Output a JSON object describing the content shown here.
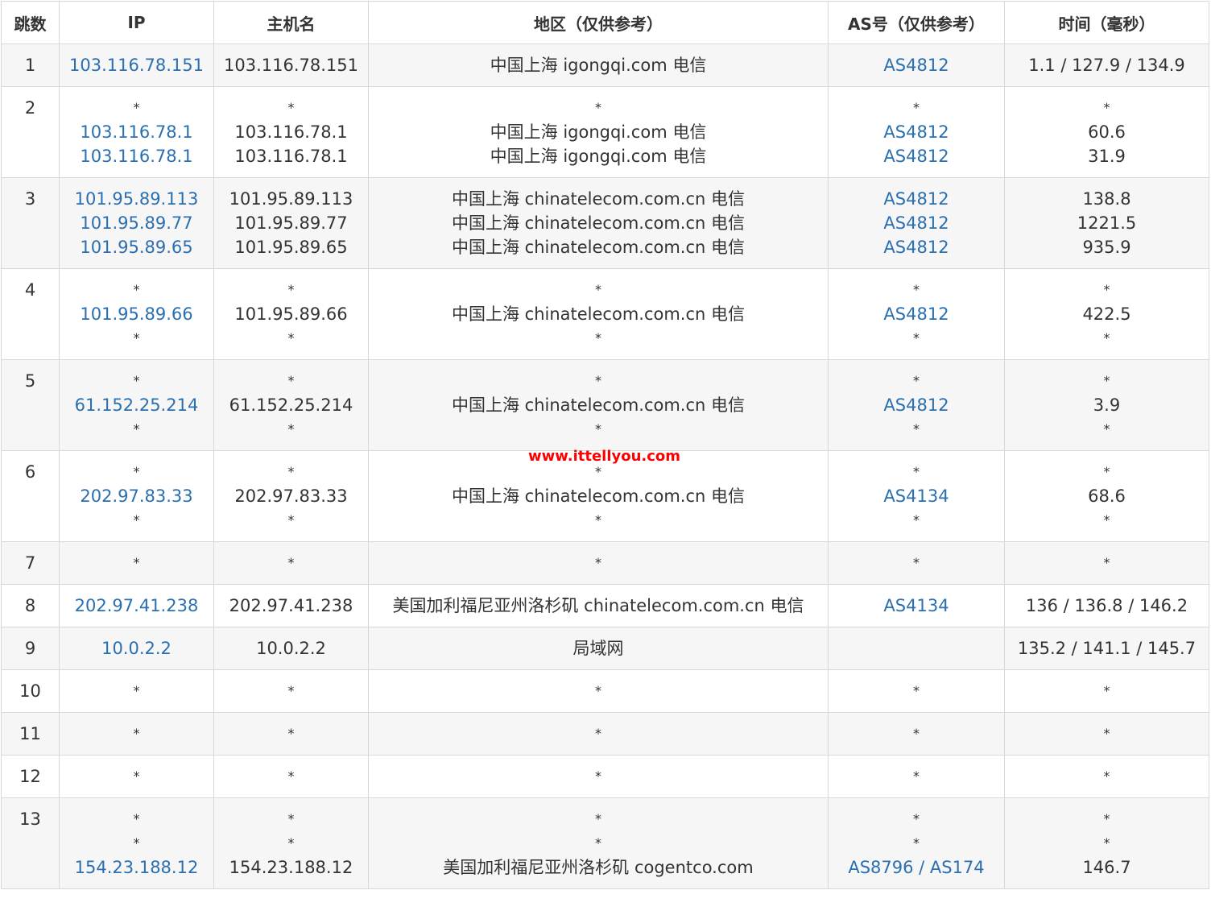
{
  "colors": {
    "link": "#2a6fb0",
    "text": "#333333",
    "stripe": "#f6f6f6",
    "border": "#d8d8d8",
    "watermark": "#ff0000"
  },
  "headers": [
    "跳数",
    "IP",
    "主机名",
    "地区（仅供参考）",
    "AS号（仅供参考）",
    "时间（毫秒）"
  ],
  "watermark": "www.ittellyou.com",
  "rows": [
    {
      "hop": "1",
      "ip": [
        "103.116.78.151"
      ],
      "host": [
        "103.116.78.151"
      ],
      "region": [
        "中国上海 igongqi.com 电信"
      ],
      "as": [
        "AS4812"
      ],
      "time": [
        "1.1 / 127.9 / 134.9"
      ]
    },
    {
      "hop": "2",
      "ip": [
        "*",
        "103.116.78.1",
        "103.116.78.1"
      ],
      "host": [
        "*",
        "103.116.78.1",
        "103.116.78.1"
      ],
      "region": [
        "*",
        "中国上海 igongqi.com 电信",
        "中国上海 igongqi.com 电信"
      ],
      "as": [
        "*",
        "AS4812",
        "AS4812"
      ],
      "time": [
        "*",
        "60.6",
        "31.9"
      ]
    },
    {
      "hop": "3",
      "ip": [
        "101.95.89.113",
        "101.95.89.77",
        "101.95.89.65"
      ],
      "host": [
        "101.95.89.113",
        "101.95.89.77",
        "101.95.89.65"
      ],
      "region": [
        "中国上海 chinatelecom.com.cn 电信",
        "中国上海 chinatelecom.com.cn 电信",
        "中国上海 chinatelecom.com.cn 电信"
      ],
      "as": [
        "AS4812",
        "AS4812",
        "AS4812"
      ],
      "time": [
        "138.8",
        "1221.5",
        "935.9"
      ]
    },
    {
      "hop": "4",
      "ip": [
        "*",
        "101.95.89.66",
        "*"
      ],
      "host": [
        "*",
        "101.95.89.66",
        "*"
      ],
      "region": [
        "*",
        "中国上海 chinatelecom.com.cn 电信",
        "*"
      ],
      "as": [
        "*",
        "AS4812",
        "*"
      ],
      "time": [
        "*",
        "422.5",
        "*"
      ]
    },
    {
      "hop": "5",
      "ip": [
        "*",
        "61.152.25.214",
        "*"
      ],
      "host": [
        "*",
        "61.152.25.214",
        "*"
      ],
      "region": [
        "*",
        "中国上海 chinatelecom.com.cn 电信",
        "*"
      ],
      "as": [
        "*",
        "AS4812",
        "*"
      ],
      "time": [
        "*",
        "3.9",
        "*"
      ]
    },
    {
      "hop": "6",
      "ip": [
        "*",
        "202.97.83.33",
        "*"
      ],
      "host": [
        "*",
        "202.97.83.33",
        "*"
      ],
      "region": [
        "*",
        "中国上海 chinatelecom.com.cn 电信",
        "*"
      ],
      "as": [
        "*",
        "AS4134",
        "*"
      ],
      "time": [
        "*",
        "68.6",
        "*"
      ]
    },
    {
      "hop": "7",
      "ip": [
        "*"
      ],
      "host": [
        "*"
      ],
      "region": [
        "*"
      ],
      "as": [
        "*"
      ],
      "time": [
        "*"
      ]
    },
    {
      "hop": "8",
      "ip": [
        "202.97.41.238"
      ],
      "host": [
        "202.97.41.238"
      ],
      "region": [
        "美国加利福尼亚州洛杉矶 chinatelecom.com.cn 电信"
      ],
      "as": [
        "AS4134"
      ],
      "time": [
        "136 / 136.8 / 146.2"
      ]
    },
    {
      "hop": "9",
      "ip": [
        "10.0.2.2"
      ],
      "host": [
        "10.0.2.2"
      ],
      "region": [
        "局域网"
      ],
      "as": [
        ""
      ],
      "time": [
        "135.2 / 141.1 / 145.7"
      ]
    },
    {
      "hop": "10",
      "ip": [
        "*"
      ],
      "host": [
        "*"
      ],
      "region": [
        "*"
      ],
      "as": [
        "*"
      ],
      "time": [
        "*"
      ]
    },
    {
      "hop": "11",
      "ip": [
        "*"
      ],
      "host": [
        "*"
      ],
      "region": [
        "*"
      ],
      "as": [
        "*"
      ],
      "time": [
        "*"
      ]
    },
    {
      "hop": "12",
      "ip": [
        "*"
      ],
      "host": [
        "*"
      ],
      "region": [
        "*"
      ],
      "as": [
        "*"
      ],
      "time": [
        "*"
      ]
    },
    {
      "hop": "13",
      "ip": [
        "*",
        "*",
        "154.23.188.12"
      ],
      "host": [
        "*",
        "*",
        "154.23.188.12"
      ],
      "region": [
        "*",
        "*",
        "美国加利福尼亚州洛杉矶 cogentco.com"
      ],
      "as": [
        "*",
        "*",
        "AS8796 / AS174"
      ],
      "time": [
        "*",
        "*",
        "146.7"
      ]
    }
  ]
}
